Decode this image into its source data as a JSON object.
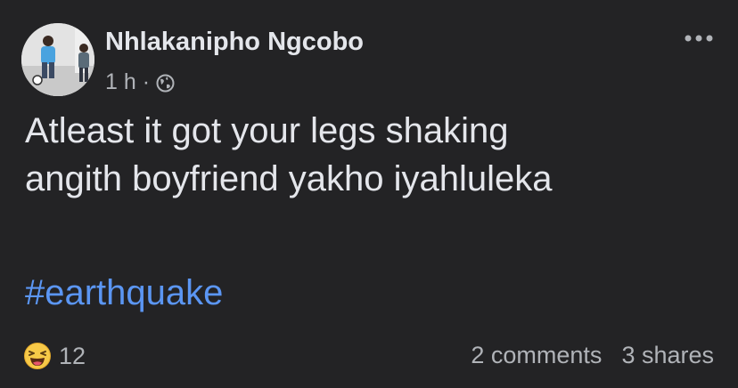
{
  "post": {
    "author": {
      "name": "Nhlakanipho Ngcobo",
      "avatar_icon": "profile-photo"
    },
    "timestamp": "1 h",
    "separator": "·",
    "privacy_icon": "globe-icon",
    "more_icon": "more-options-icon",
    "text_lines": [
      "Atleast it got your legs shaking",
      "angith boyfriend yakho iyahluleka"
    ],
    "hashtag": "#earthquake",
    "reactions": {
      "icon": "haha-reaction-icon",
      "count": "12"
    },
    "comments": "2 comments",
    "shares": "3 shares"
  },
  "colors": {
    "background": "#232325",
    "primary_text": "#e4e6eb",
    "secondary_text": "#b0b3b8",
    "hashtag": "#5b96f3",
    "reaction_yellow": "#f7c948"
  }
}
